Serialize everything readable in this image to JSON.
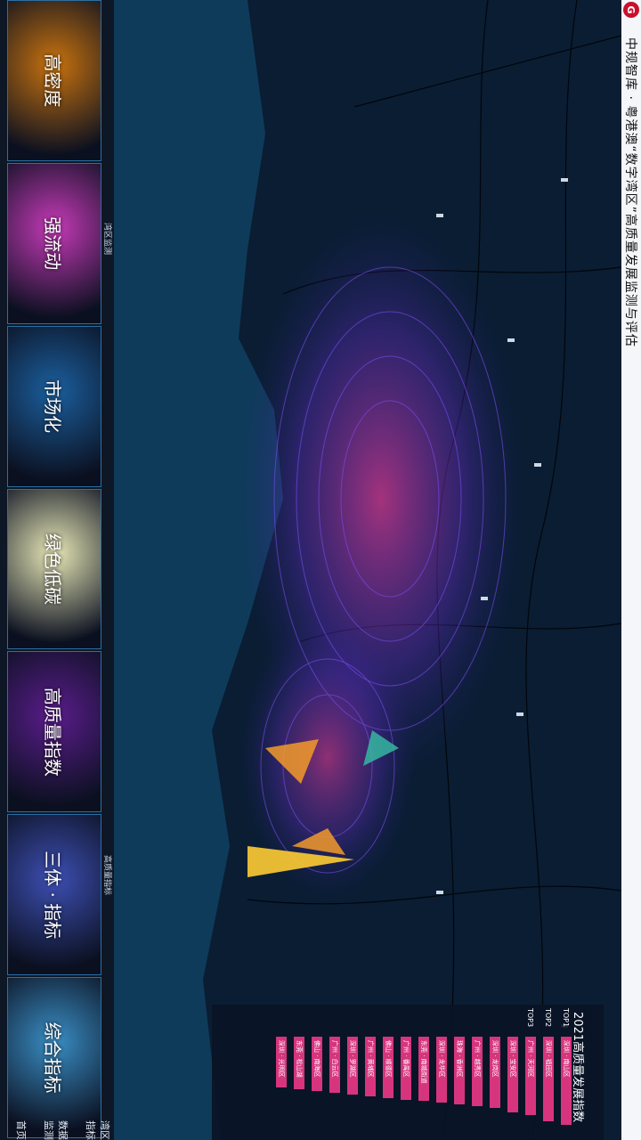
{
  "header": {
    "title": "中规智库 · 粤港澳“数字湾区”高质量发展监测与评估",
    "logo": "G"
  },
  "nav": {
    "tabs": [
      {
        "label": "首页"
      },
      {
        "label": "数据监测"
      },
      {
        "label": "湾区指标"
      }
    ]
  },
  "ranking": {
    "title": "2021高质量发展指数",
    "top_labels": [
      "TOP1",
      "TOP2",
      "TOP3"
    ],
    "items": [
      {
        "name": "深圳 · 南山区",
        "value": 100
      },
      {
        "name": "深圳 · 福田区",
        "value": 96
      },
      {
        "name": "广州 · 天河区",
        "value": 88
      },
      {
        "name": "深圳 · 宝安区",
        "value": 85
      },
      {
        "name": "深圳 · 龙岗区",
        "value": 80
      },
      {
        "name": "广州 · 越秀区",
        "value": 78
      },
      {
        "name": "珠海 · 香洲区",
        "value": 76
      },
      {
        "name": "深圳 · 龙华区",
        "value": 74
      },
      {
        "name": "东莞 · 南城街道",
        "value": 72
      },
      {
        "name": "广州 · 番禺区",
        "value": 70
      },
      {
        "name": "佛山 · 顺德区",
        "value": 68
      },
      {
        "name": "广州 · 黄埔区",
        "value": 66
      },
      {
        "name": "深圳 · 罗湖区",
        "value": 64
      },
      {
        "name": "广州 · 白云区",
        "value": 62
      },
      {
        "name": "佛山 · 南海区",
        "value": 60
      },
      {
        "name": "东莞 · 松山湖",
        "value": 58
      },
      {
        "name": "深圳 · 光明区",
        "value": 56
      }
    ]
  },
  "strip": {
    "group_labels": [
      "湾区监测",
      "高质量指标"
    ],
    "thumbs": [
      {
        "label": "高密度",
        "color": "#c9730e"
      },
      {
        "label": "强流动",
        "color": "#c63ab8"
      },
      {
        "label": "市场化",
        "color": "#1b5f9e"
      },
      {
        "label": "绿色低碳",
        "color": "#e9e9b8"
      },
      {
        "label": "高质量指数",
        "color": "#5a1d8c"
      },
      {
        "label": "三体 · 指标",
        "color": "#3d4fb3"
      },
      {
        "label": "综合指标",
        "color": "#3a8fc6"
      }
    ]
  },
  "colors": {
    "accent": "#d6357e",
    "map_bg": "#0c2b45",
    "land": "#0a1d33",
    "sea": "#103d5c"
  }
}
